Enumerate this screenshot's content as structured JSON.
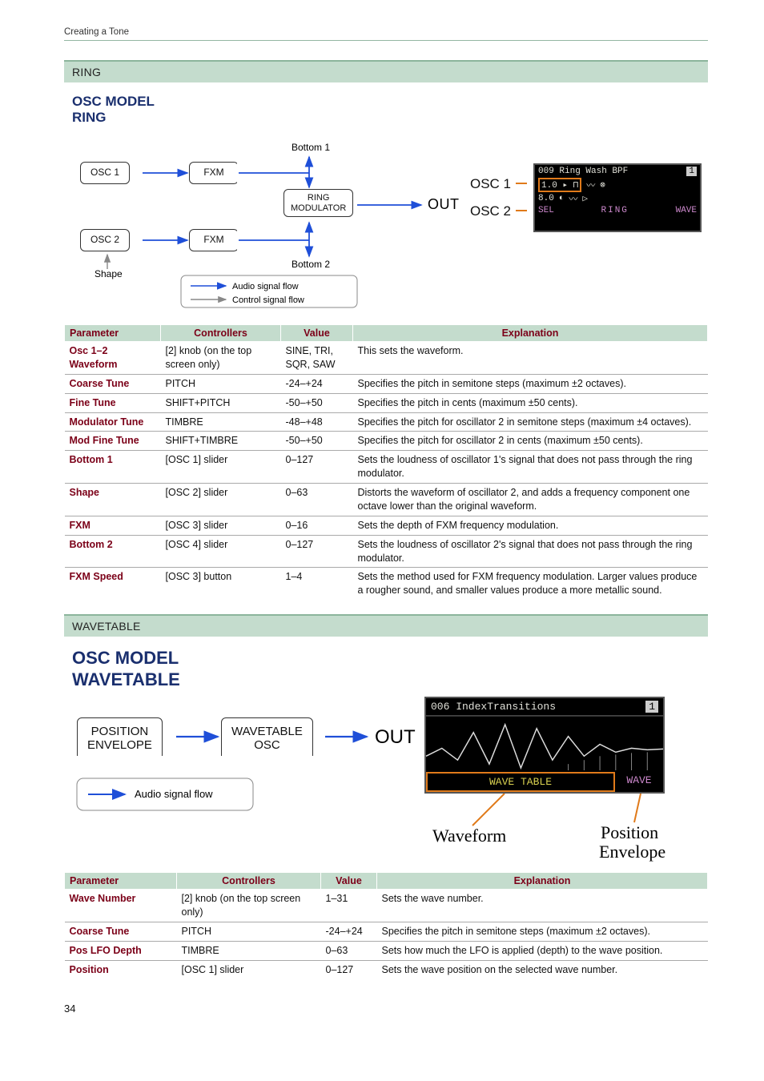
{
  "breadcrumb": "Creating a Tone",
  "page_number": "34",
  "ring": {
    "section_title": "RING",
    "model_l1": "OSC MODEL",
    "model_l2": "RING",
    "diagram": {
      "osc1": "OSC 1",
      "osc2": "OSC 2",
      "fxm": "FXM",
      "bottom1": "Bottom 1",
      "bottom2": "Bottom 2",
      "ringmod_l1": "RING",
      "ringmod_l2": "MODULATOR",
      "out": "OUT",
      "shape": "Shape",
      "legend_audio": "Audio signal flow",
      "legend_control": "Control signal flow",
      "side_osc1": "OSC 1",
      "side_osc2": "OSC 2",
      "dev_top": "009 Ring Wash BPF",
      "dev_v1": "1.0",
      "dev_v2": "8.0",
      "dev_sel": "SEL",
      "dev_ring": "RING",
      "dev_wave": "WAVE",
      "dev_corner": "1"
    },
    "table": {
      "headers": {
        "param": "Parameter",
        "ctrl": "Controllers",
        "val": "Value",
        "exp": "Explanation"
      },
      "rows": [
        {
          "param": "Osc 1–2 Waveform",
          "ctrl": "[2] knob (on the top screen only)",
          "val": "SINE, TRI, SQR, SAW",
          "exp": "This sets the waveform."
        },
        {
          "param": "Coarse Tune",
          "ctrl": "PITCH",
          "val": "-24–+24",
          "exp": "Specifies the pitch in semitone steps (maximum ±2 octaves)."
        },
        {
          "param": "Fine Tune",
          "ctrl": "SHIFT+PITCH",
          "val": "-50–+50",
          "exp": "Specifies the pitch in cents (maximum ±50 cents)."
        },
        {
          "param": "Modulator Tune",
          "ctrl": "TIMBRE",
          "val": "-48–+48",
          "exp": "Specifies the pitch for oscillator 2 in semitone steps (maximum ±4 octaves)."
        },
        {
          "param": "Mod Fine Tune",
          "ctrl": "SHIFT+TIMBRE",
          "val": "-50–+50",
          "exp": "Specifies the pitch for oscillator 2 in cents (maximum ±50 cents)."
        },
        {
          "param": "Bottom 1",
          "ctrl": "[OSC 1] slider",
          "val": "0–127",
          "exp": "Sets the loudness of oscillator 1's signal that does not pass through the ring modulator."
        },
        {
          "param": "Shape",
          "ctrl": "[OSC 2] slider",
          "val": "0–63",
          "exp": "Distorts the waveform of oscillator 2, and adds a frequency component one octave lower than the original waveform."
        },
        {
          "param": "FXM",
          "ctrl": "[OSC 3] slider",
          "val": "0–16",
          "exp": "Sets the depth of FXM frequency modulation."
        },
        {
          "param": "Bottom 2",
          "ctrl": "[OSC 4] slider",
          "val": "0–127",
          "exp": "Sets the loudness of oscillator 2's signal that does not pass through the ring modulator."
        },
        {
          "param": "FXM Speed",
          "ctrl": "[OSC 3] button",
          "val": "1–4",
          "exp": "Sets the method used for FXM frequency modulation.\nLarger values produce a rougher sound, and smaller values produce a more metallic sound."
        }
      ]
    }
  },
  "wavetable": {
    "section_title": "WAVETABLE",
    "model_l1": "OSC MODEL",
    "model_l2": "WAVETABLE",
    "diagram": {
      "posenv_l1": "POSITION",
      "posenv_l2": "ENVELOPE",
      "wtosc_l1": "WAVETABLE",
      "wtosc_l2": "OSC",
      "out": "OUT",
      "legend_audio": "Audio signal flow",
      "dev_top": "006 IndexTransitions",
      "dev_corner": "1",
      "dev_wt": "WAVE TABLE",
      "dev_wave": "WAVE",
      "annot_waveform": "Waveform",
      "annot_position_l1": "Position",
      "annot_position_l2": "Envelope"
    },
    "table": {
      "headers": {
        "param": "Parameter",
        "ctrl": "Controllers",
        "val": "Value",
        "exp": "Explanation"
      },
      "rows": [
        {
          "param": "Wave Number",
          "ctrl": "[2] knob (on the top screen only)",
          "val": "1–31",
          "exp": "Sets the wave number."
        },
        {
          "param": "Coarse Tune",
          "ctrl": "PITCH",
          "val": "-24–+24",
          "exp": "Specifies the pitch in semitone steps (maximum ±2 octaves)."
        },
        {
          "param": "Pos LFO Depth",
          "ctrl": "TIMBRE",
          "val": "0–63",
          "exp": "Sets how much the LFO is applied (depth) to the wave position."
        },
        {
          "param": "Position",
          "ctrl": "[OSC 1] slider",
          "val": "0–127",
          "exp": "Sets the wave position on the selected wave number."
        }
      ]
    }
  }
}
